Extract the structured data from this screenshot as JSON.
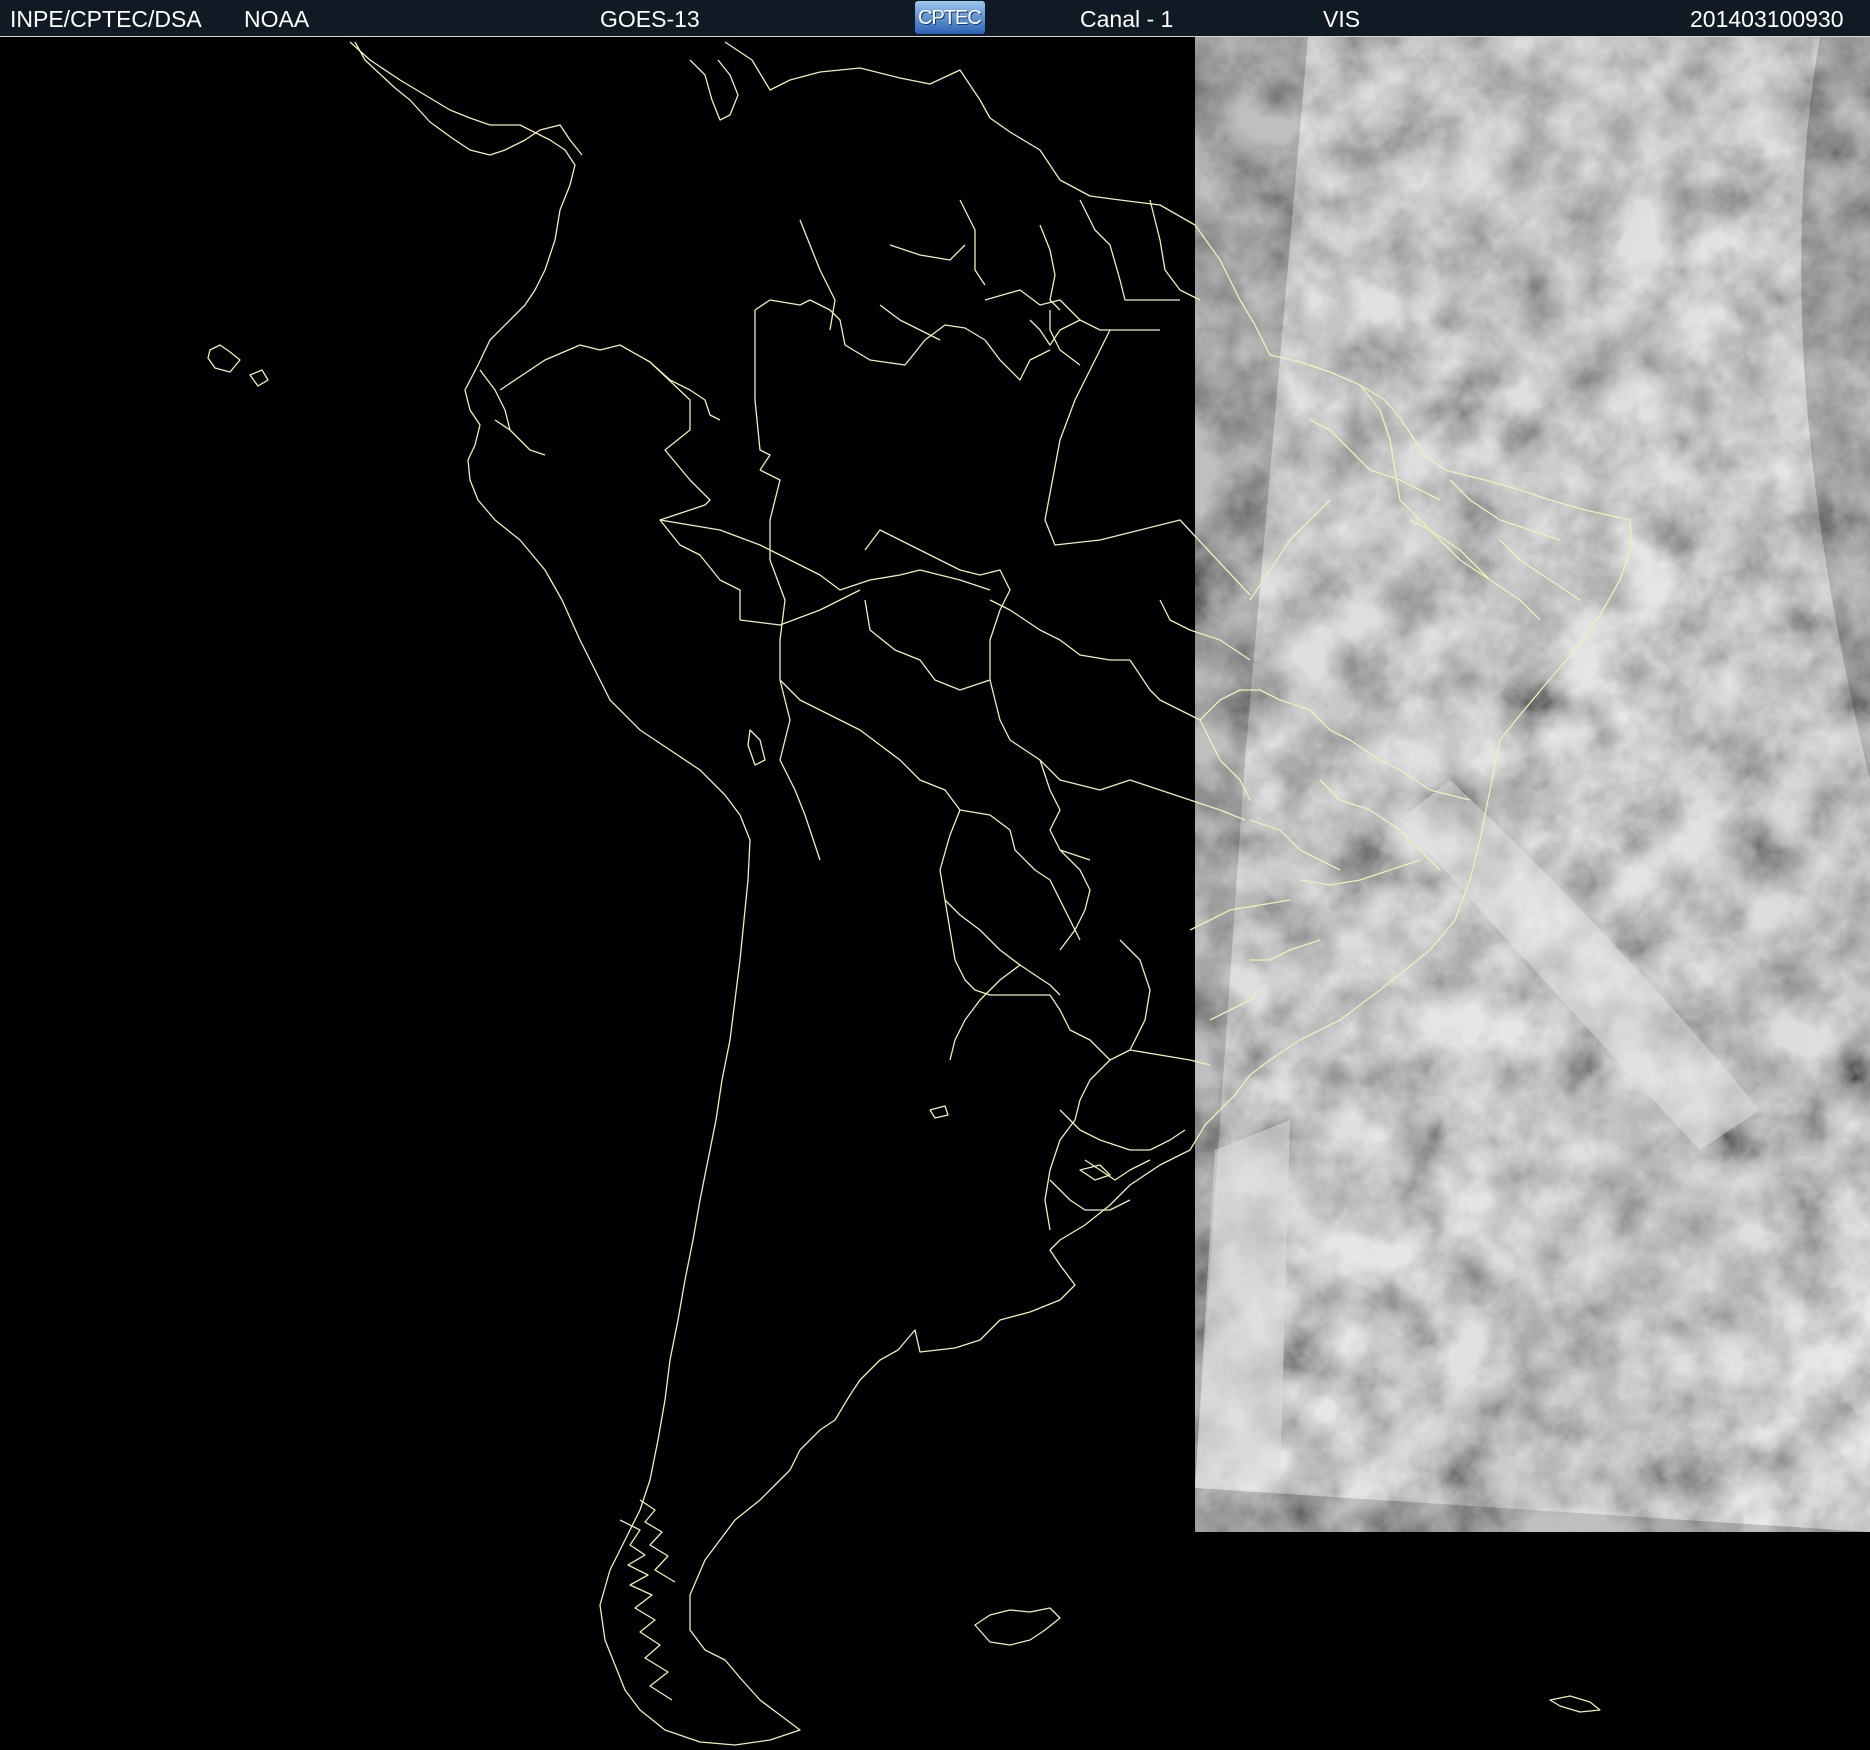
{
  "header": {
    "agency": "INPE/CPTEC/DSA",
    "source": "NOAA",
    "satellite": "GOES-13",
    "logo_text": "CPTEC",
    "channel": "Canal - 1",
    "band": "VIS",
    "datetime": "201403100930"
  },
  "colors": {
    "header_bg": "#0f1a24",
    "header_text": "#ffffff",
    "borders": "#f1efb3",
    "background": "#000000"
  }
}
